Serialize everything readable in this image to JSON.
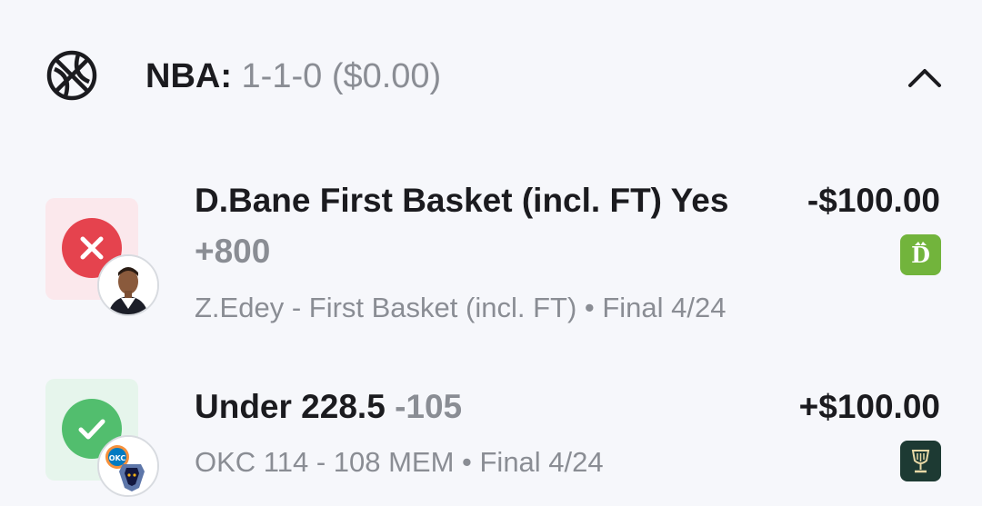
{
  "header": {
    "league": "NBA:",
    "record": "1-1-0 ($0.00)",
    "icon": "basketball-icon",
    "collapse_icon": "chevron-up-icon"
  },
  "bets": [
    {
      "title": "D.Bane First Basket (incl. FT) Yes",
      "odds": "+800",
      "subtitle": "Z.Edey - First Basket (incl. FT) • Final 4/24",
      "amount": "-$100.00",
      "result": "loss",
      "status_icon": "x-icon",
      "avatar_icon": "player-avatar-icon",
      "book_icon": "draftkings-logo-icon"
    },
    {
      "title": "Under 228.5",
      "odds": "-105",
      "subtitle": "OKC 114 - 108 MEM • Final 4/24",
      "amount": "+$100.00",
      "result": "win",
      "status_icon": "check-icon",
      "avatar_icon": "team-logos-icon",
      "book_icon": "sportsbook-trophy-logo-icon"
    }
  ],
  "colors": {
    "loss_red": "#e5434e",
    "win_green": "#52be6e",
    "loss_tile": "#fbe8ec",
    "win_tile": "#e6f5ec",
    "text_muted": "#8a8d94"
  }
}
